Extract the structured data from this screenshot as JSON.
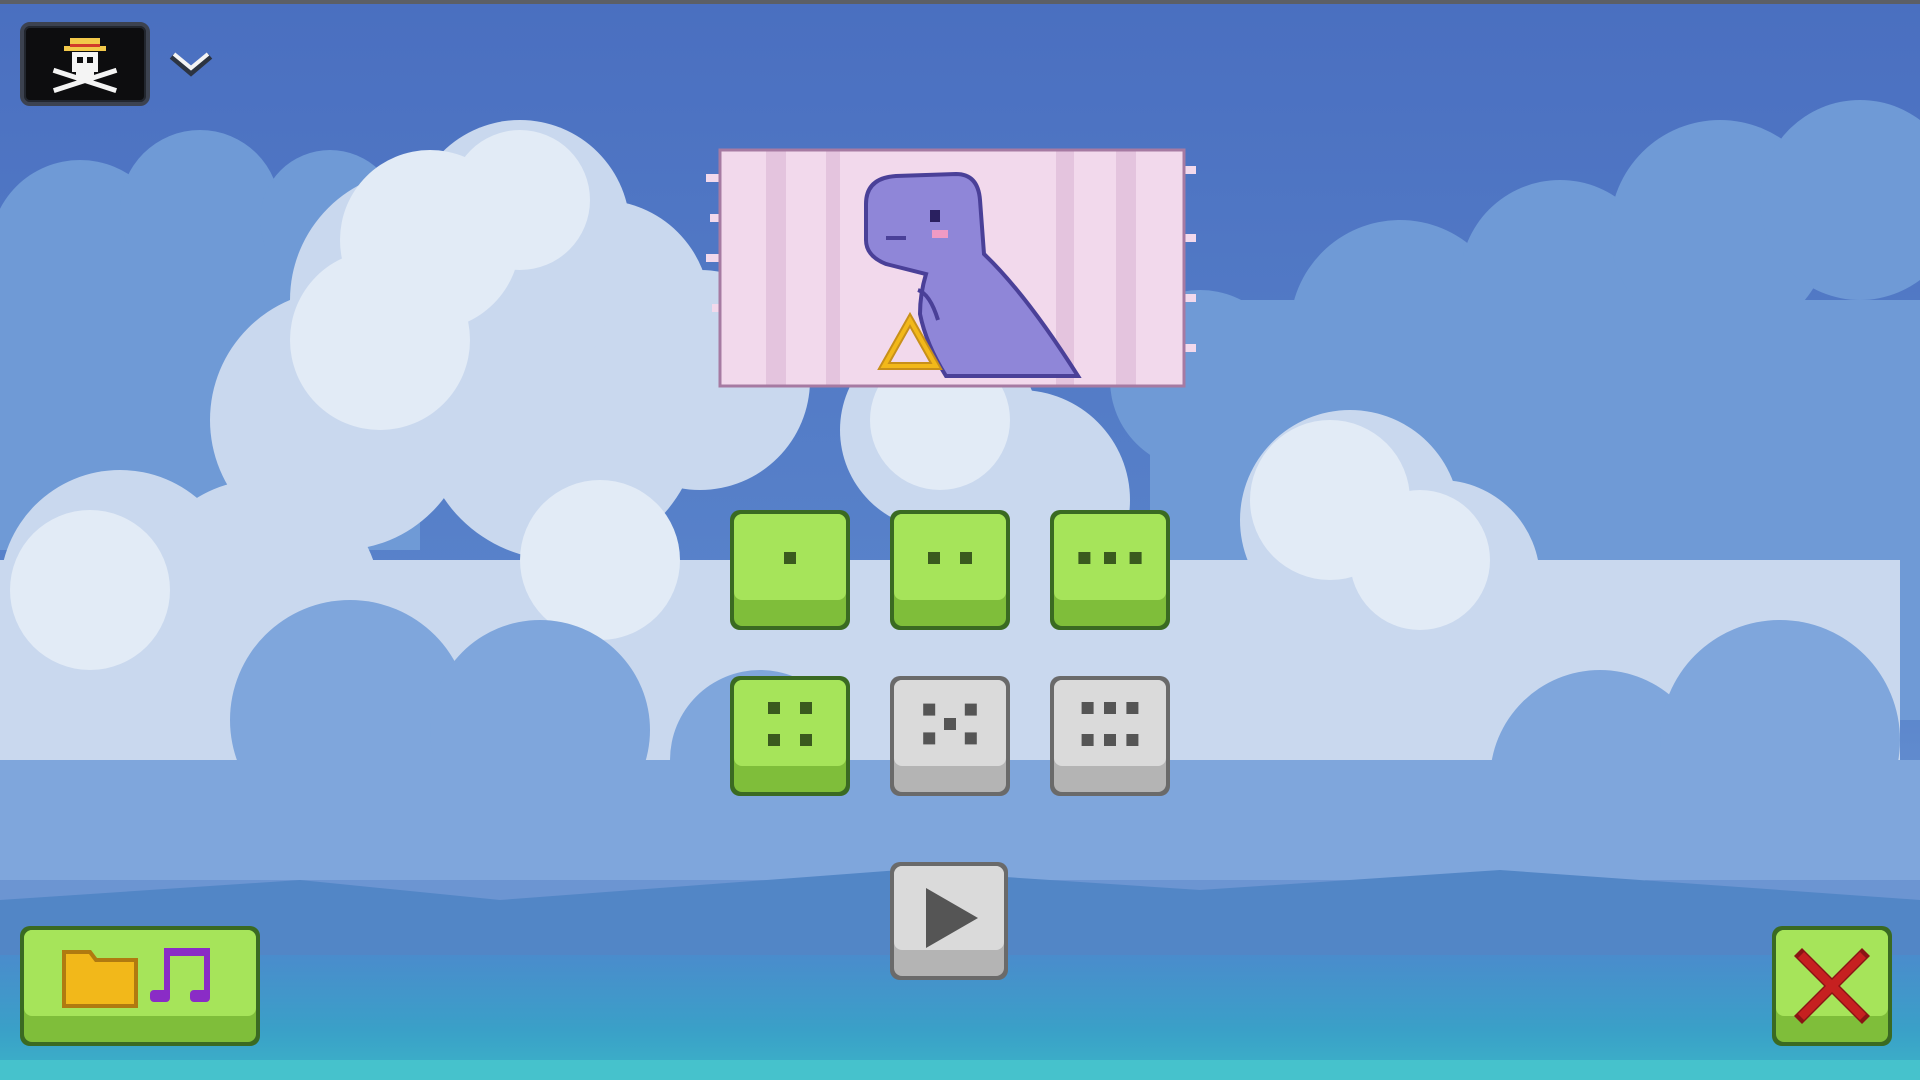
{
  "scene": {
    "sky_color": "#4a72c2",
    "sea_color": "#3f8ec8",
    "cloud_color": "#dce6f3"
  },
  "header": {
    "flag_icon": "pirate-skull-flag-icon",
    "dropdown_icon": "chevron-down-icon"
  },
  "banner": {
    "icon": "purple-dinosaur-icon",
    "background": "#f0d8ea",
    "character_color": "#8f86d8"
  },
  "levels": [
    {
      "pips": 1,
      "state": "unlocked",
      "icon": "dice-one-icon"
    },
    {
      "pips": 2,
      "state": "unlocked",
      "icon": "dice-two-icon"
    },
    {
      "pips": 3,
      "state": "unlocked",
      "icon": "dice-three-icon"
    },
    {
      "pips": 4,
      "state": "unlocked",
      "icon": "dice-four-icon"
    },
    {
      "pips": 5,
      "state": "locked",
      "icon": "dice-five-icon"
    },
    {
      "pips": 6,
      "state": "locked",
      "icon": "dice-six-icon"
    }
  ],
  "colors": {
    "unlocked_top": "#a6e45a",
    "unlocked_bottom": "#7fbe3a",
    "unlocked_border": "#3a6a22",
    "locked_top": "#dadada",
    "locked_bottom": "#b4b4b4",
    "locked_border": "#6a6a6a",
    "pip": "#3a5a1e",
    "locked_pip": "#555555",
    "close_x": "#c62020",
    "folder": "#f2b81a",
    "music": "#8a2cc6"
  },
  "controls": {
    "play_icon": "play-icon",
    "folder_icon": "folder-icon",
    "music_icon": "music-note-icon",
    "close_icon": "close-icon"
  }
}
